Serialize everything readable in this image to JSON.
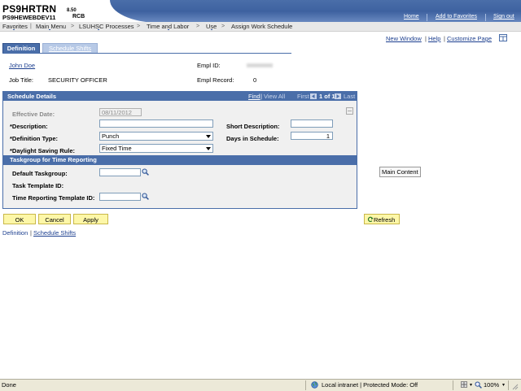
{
  "header": {
    "app_name": "PS9HRTRN",
    "version": "8.50",
    "database": "PS9HEWEBDEV11",
    "user_code": "RCB",
    "links": {
      "home": "Home",
      "add_favorites": "Add to Favorites",
      "sign_out": "Sign out"
    }
  },
  "breadcrumb": [
    "Favorites",
    "Main Menu",
    "LSUHSC Processes",
    "Time and Labor",
    "Use",
    "Assign Work Schedule"
  ],
  "tabs": [
    {
      "label": "Definition",
      "active": true
    },
    {
      "label": "Schedule Shifts",
      "active": false
    }
  ],
  "page_links": {
    "new_window": "New Window",
    "help": "Help",
    "customize": "Customize Page"
  },
  "employee": {
    "name": "John Doe",
    "job_title_label": "Job Title:",
    "job_title": "SECURITY OFFICER",
    "empl_id_label": "Empl ID:",
    "empl_record_label": "Empl Record:",
    "empl_record": "0"
  },
  "schedule": {
    "title": "Schedule Details",
    "nav": {
      "find": "Find",
      "view_all": "View All",
      "first": "First",
      "counter": "1 of 1",
      "last": "Last"
    },
    "effective_date_label": "Effective Date:",
    "effective_date": "08/11/2012",
    "description_label": "*Description:",
    "description": "",
    "short_description_label": "Short Description:",
    "short_description": "",
    "definition_type_label": "*Definition Type:",
    "definition_type": "Punch",
    "days_in_schedule_label": "Days in Schedule:",
    "days_in_schedule": "1",
    "dst_rule_label": "*Daylight Saving Rule:",
    "dst_rule": "Fixed Time"
  },
  "taskgroup": {
    "title": "Taskgroup for Time Reporting",
    "default_taskgroup_label": "Default Taskgroup:",
    "default_taskgroup": "",
    "task_template_label": "Task Template ID:",
    "trt_label": "Time Reporting Template ID:",
    "trt": ""
  },
  "buttons": {
    "ok": "OK",
    "cancel": "Cancel",
    "apply": "Apply",
    "refresh": "Refresh"
  },
  "footer_links": {
    "definition": "Definition",
    "schedule_shifts": "Schedule Shifts"
  },
  "tooltip": "Main Content",
  "statusbar": {
    "left": "Done",
    "zone": "Local intranet | Protected Mode: Off",
    "zoom": "100%"
  },
  "colors": {
    "accent": "#4a6ea9",
    "button": "#fdf7a8",
    "link": "#1c3f8f"
  }
}
